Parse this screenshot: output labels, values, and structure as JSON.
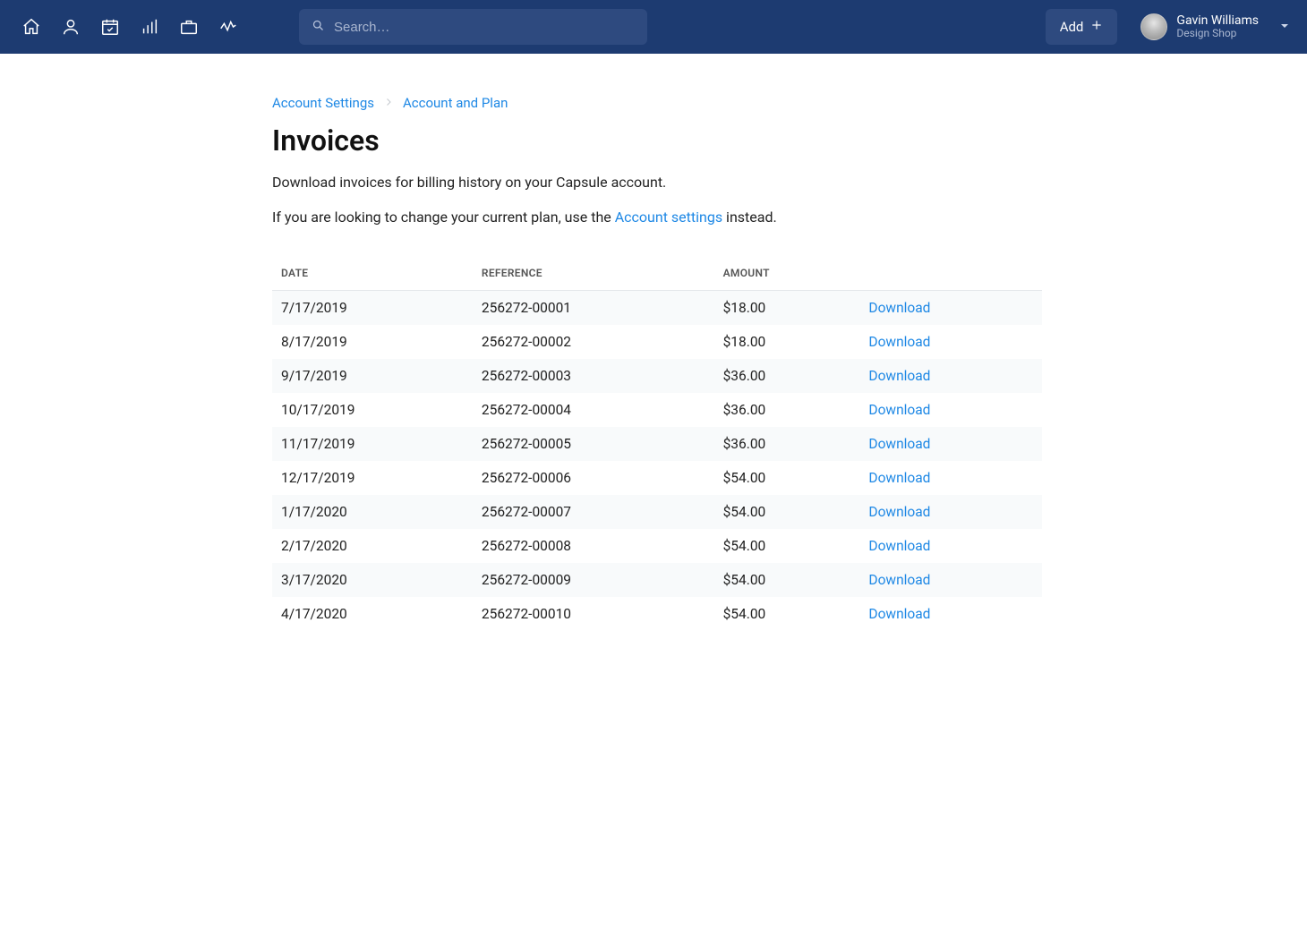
{
  "header": {
    "search_placeholder": "Search…",
    "add_label": "Add",
    "user": {
      "name": "Gavin Williams",
      "subtitle": "Design Shop"
    }
  },
  "breadcrumbs": {
    "root": "Account Settings",
    "current": "Account and Plan"
  },
  "page": {
    "title": "Invoices",
    "subtitle": "Download invoices for billing history on your Capsule account.",
    "plan_prefix": "If you are looking to change your current plan, use the ",
    "plan_link": "Account settings",
    "plan_suffix": " instead."
  },
  "table": {
    "headers": {
      "date": "DATE",
      "reference": "REFERENCE",
      "amount": "AMOUNT"
    },
    "download_label": "Download",
    "rows": [
      {
        "date": "7/17/2019",
        "reference": "256272-00001",
        "amount": "$18.00"
      },
      {
        "date": "8/17/2019",
        "reference": "256272-00002",
        "amount": "$18.00"
      },
      {
        "date": "9/17/2019",
        "reference": "256272-00003",
        "amount": "$36.00"
      },
      {
        "date": "10/17/2019",
        "reference": "256272-00004",
        "amount": "$36.00"
      },
      {
        "date": "11/17/2019",
        "reference": "256272-00005",
        "amount": "$36.00"
      },
      {
        "date": "12/17/2019",
        "reference": "256272-00006",
        "amount": "$54.00"
      },
      {
        "date": "1/17/2020",
        "reference": "256272-00007",
        "amount": "$54.00"
      },
      {
        "date": "2/17/2020",
        "reference": "256272-00008",
        "amount": "$54.00"
      },
      {
        "date": "3/17/2020",
        "reference": "256272-00009",
        "amount": "$54.00"
      },
      {
        "date": "4/17/2020",
        "reference": "256272-00010",
        "amount": "$54.00"
      }
    ]
  }
}
